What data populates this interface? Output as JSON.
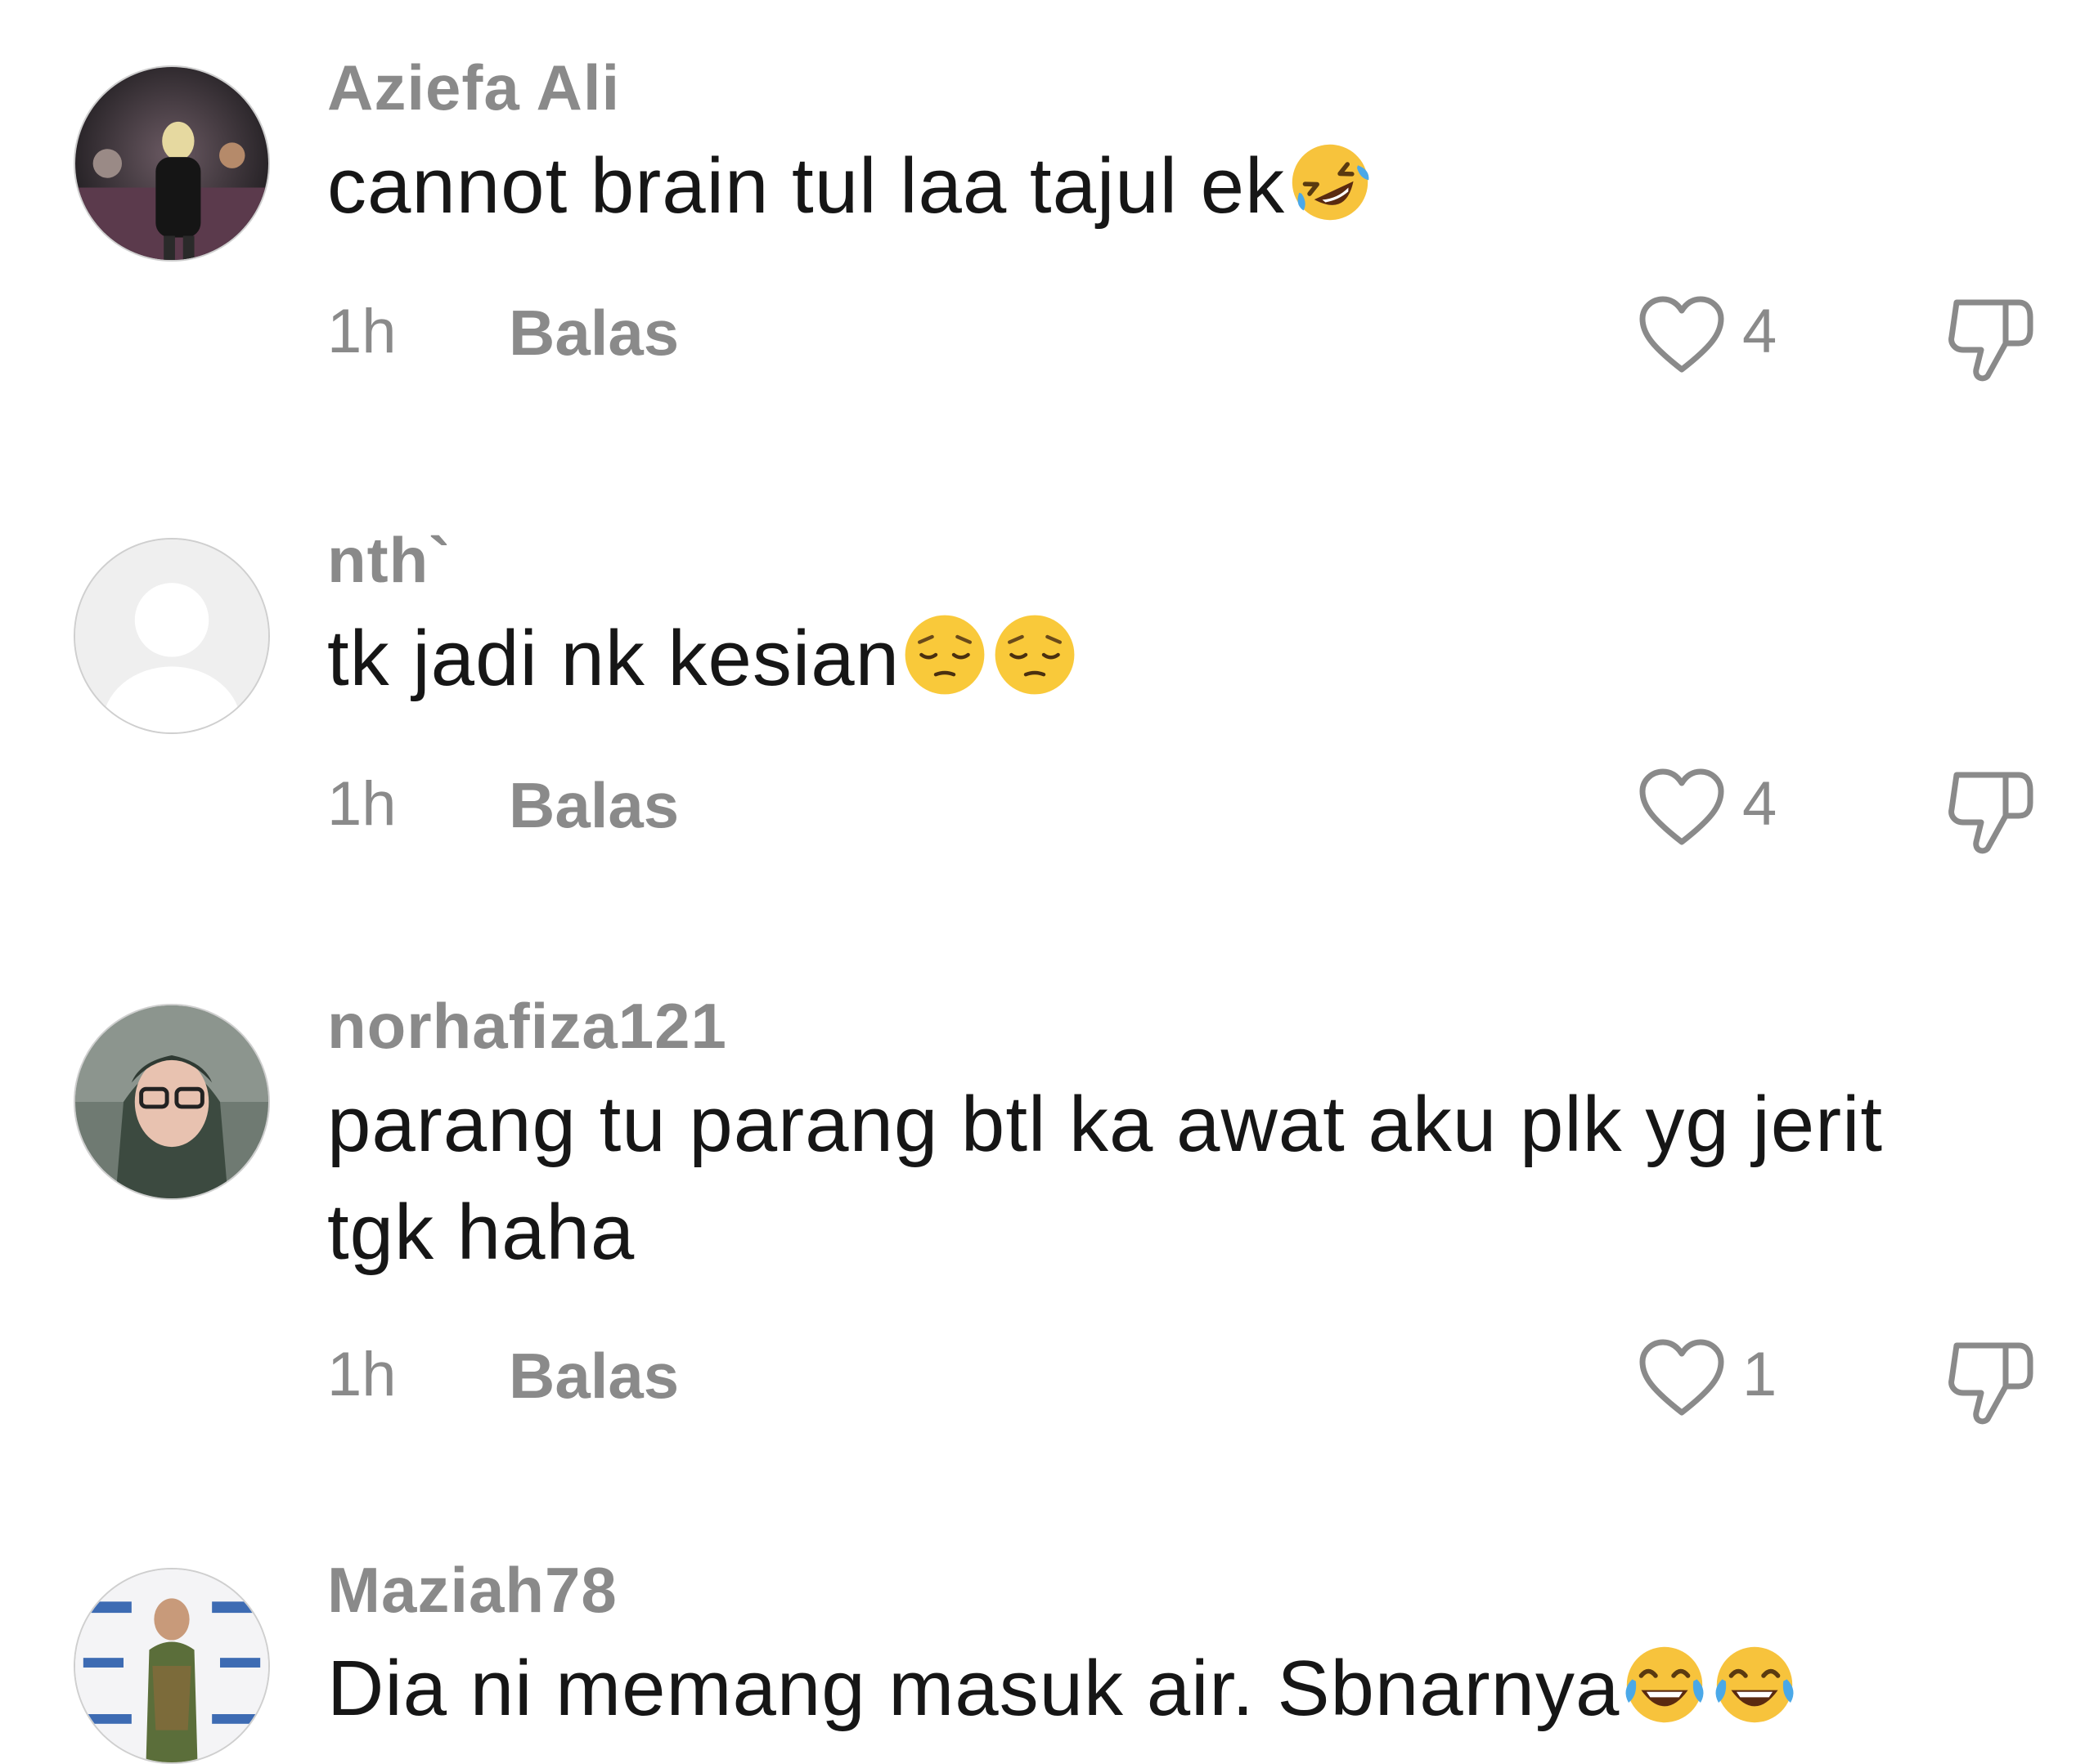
{
  "comments": [
    {
      "username": "Aziefa Ali",
      "text": "cannot brain tul laa tajul ek",
      "emojis": [
        "rolling-on-floor-laughing"
      ],
      "time": "1h",
      "reply_label": "Balas",
      "likes": "4"
    },
    {
      "username": "nth`",
      "text": "tk jadi nk kesian",
      "emojis": [
        "pensive-face",
        "pensive-face"
      ],
      "time": "1h",
      "reply_label": "Balas",
      "likes": "4"
    },
    {
      "username": "norhafiza121",
      "text": "parang tu parang btl ka awat aku plk yg jerit tgk haha",
      "emojis": [],
      "time": "1h",
      "reply_label": "Balas",
      "likes": "1"
    },
    {
      "username": "Maziah78",
      "text": "Dia ni memang masuk air. Sbnarnya",
      "emojis": [
        "face-with-tears-of-joy",
        "face-with-tears-of-joy"
      ],
      "time": "",
      "reply_label": "",
      "likes": ""
    }
  ],
  "colors": {
    "secondary_text": "#8a8a8a",
    "primary_text": "#161616",
    "icon_stroke": "#8a8a8a"
  }
}
